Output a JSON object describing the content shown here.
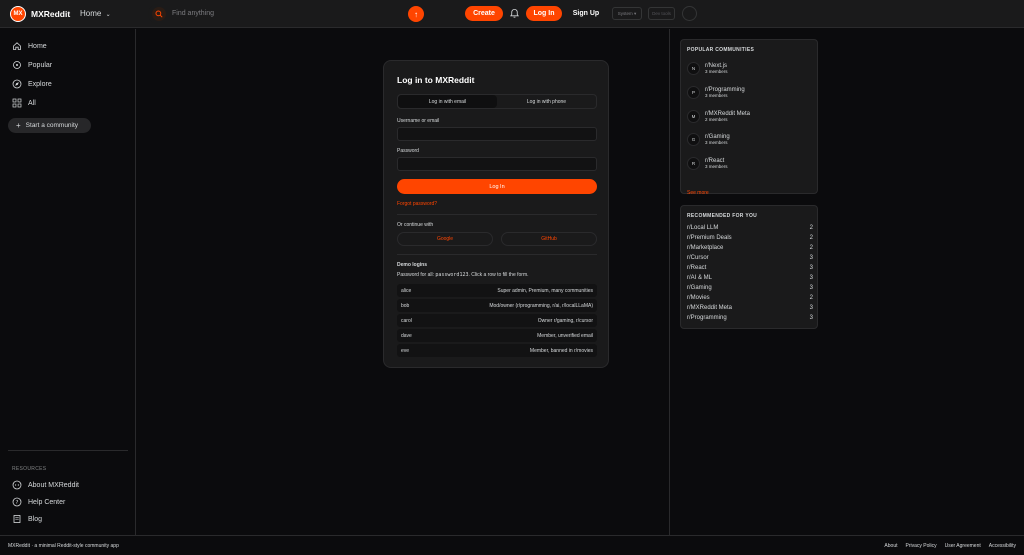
{
  "header": {
    "logo_text": "MX",
    "brand": "MXReddit",
    "home_dropdown": "Home",
    "search_placeholder": "Find anything",
    "search_button": "↑",
    "create_label": "Create",
    "login_label": "Log In",
    "signup_label": "Sign Up",
    "theme_label": "System ▾",
    "dev_label": "Dev tools",
    "accent_color": "#ff4500"
  },
  "sidebar": {
    "items": [
      {
        "label": "Home",
        "icon": "home-icon"
      },
      {
        "label": "Popular",
        "icon": "popular-icon"
      },
      {
        "label": "Explore",
        "icon": "explore-icon"
      },
      {
        "label": "All",
        "icon": "grid-icon"
      }
    ],
    "start_community": "Start a community",
    "resources_title": "RESOURCES",
    "resources": [
      {
        "label": "About MXReddit",
        "icon": "reddit-icon"
      },
      {
        "label": "Help Center",
        "icon": "help-icon"
      },
      {
        "label": "Blog",
        "icon": "blog-icon"
      }
    ]
  },
  "login": {
    "title": "Log in to MXReddit",
    "tab_email": "Log in with email",
    "tab_phone": "Log in with phone",
    "username_label": "Username or email",
    "password_label": "Password",
    "submit": "Log In",
    "forgot": "Forgot password?",
    "continue_with": "Or continue with",
    "google": "Google",
    "github": "GitHub",
    "demo_title": "Demo logins",
    "demo_note_prefix": "Password for all: ",
    "demo_password": "password123",
    "demo_note_suffix": ". Click a row to fill the form.",
    "demo_rows": [
      {
        "user": "alice",
        "desc": "Super admin, Premium, many communities"
      },
      {
        "user": "bob",
        "desc": "Mod/owner (r/programming, r/ai, r/localLLaMA)"
      },
      {
        "user": "carol",
        "desc": "Owner r/gaming, r/cursor"
      },
      {
        "user": "dave",
        "desc": "Member, unverified email"
      },
      {
        "user": "eve",
        "desc": "Member, banned in r/movies"
      }
    ]
  },
  "popular": {
    "title": "POPULAR COMMUNITIES",
    "items": [
      {
        "initial": "N",
        "name": "r/Next.js",
        "members": "3 members"
      },
      {
        "initial": "P",
        "name": "r/Programming",
        "members": "3 members"
      },
      {
        "initial": "M",
        "name": "r/MXReddit Meta",
        "members": "2 members"
      },
      {
        "initial": "G",
        "name": "r/Gaming",
        "members": "3 members"
      },
      {
        "initial": "R",
        "name": "r/React",
        "members": "3 members"
      }
    ],
    "see_more": "See more"
  },
  "recommended": {
    "title": "RECOMMENDED FOR YOU",
    "items": [
      {
        "name": "r/Local LLM",
        "count": "2"
      },
      {
        "name": "r/Premium Deals",
        "count": "2"
      },
      {
        "name": "r/Marketplace",
        "count": "2"
      },
      {
        "name": "r/Cursor",
        "count": "3"
      },
      {
        "name": "r/React",
        "count": "3"
      },
      {
        "name": "r/AI & ML",
        "count": "3"
      },
      {
        "name": "r/Gaming",
        "count": "3"
      },
      {
        "name": "r/Movies",
        "count": "2"
      },
      {
        "name": "r/MXReddit Meta",
        "count": "3"
      },
      {
        "name": "r/Programming",
        "count": "3"
      }
    ]
  },
  "footer": {
    "tagline": "MXReddit · a minimal Reddit-style community app",
    "links": [
      "About",
      "Privacy Policy",
      "User Agreement",
      "Accessibility"
    ]
  }
}
